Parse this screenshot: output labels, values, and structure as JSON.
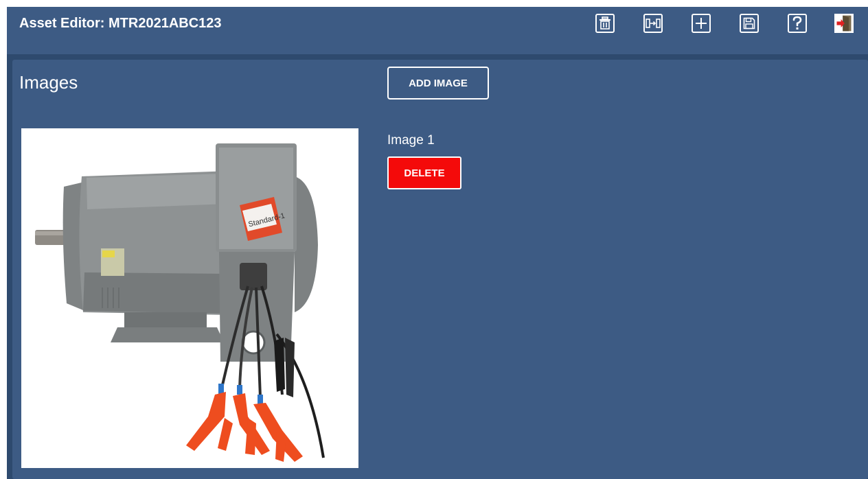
{
  "header": {
    "title": "Asset Editor: MTR2021ABC123",
    "toolbar": [
      {
        "name": "delete-asset-button",
        "icon": "trash-icon"
      },
      {
        "name": "transfer-button",
        "icon": "transfer-icon"
      },
      {
        "name": "add-button",
        "icon": "plus-icon"
      },
      {
        "name": "save-button",
        "icon": "save-icon"
      },
      {
        "name": "help-button",
        "icon": "help-icon"
      },
      {
        "name": "exit-button",
        "icon": "exit-door-icon"
      }
    ]
  },
  "images_section": {
    "title": "Images",
    "add_button_label": "ADD IMAGE",
    "items": [
      {
        "label": "Image 1",
        "delete_label": "DELETE",
        "thumbnail": "electric-motor-photo"
      }
    ]
  },
  "colors": {
    "header_bg": "#3d5b84",
    "panel_bg": "#3d5b84",
    "frame_bg": "#2e4a6e",
    "delete_red": "#f40a0a",
    "text": "#ffffff"
  }
}
